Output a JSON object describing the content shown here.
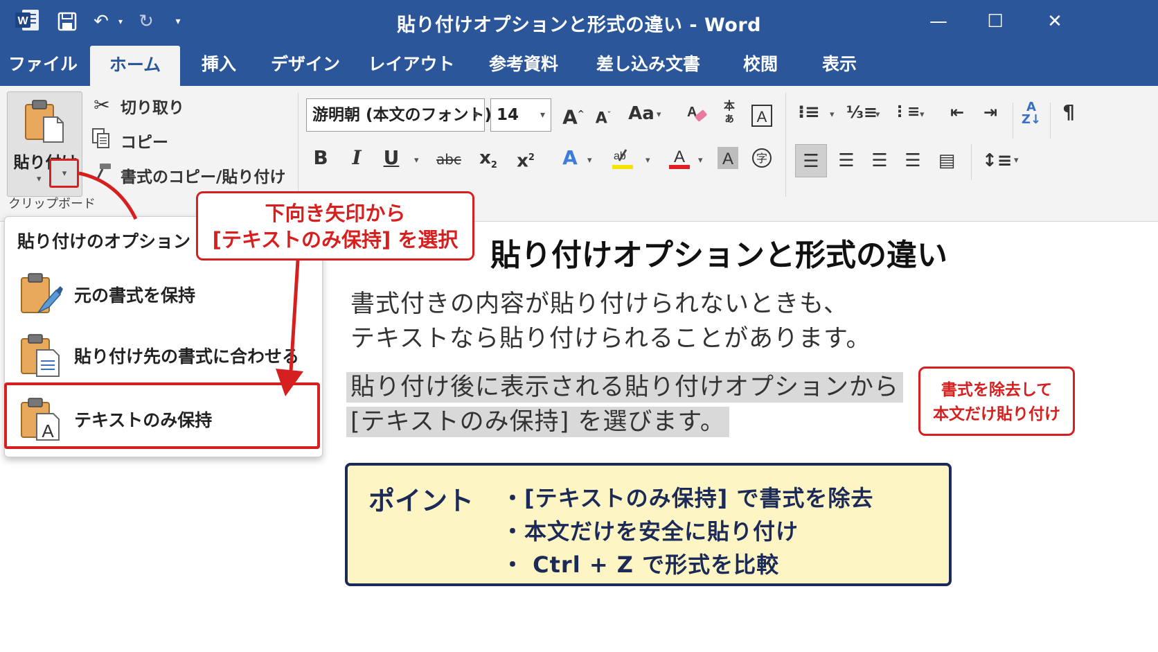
{
  "titlebar": {
    "title": "貼り付けオプションと形式の違い  -  Word",
    "icons": [
      "word-logo",
      "save-icon",
      "undo-icon",
      "redo-icon",
      "customize-icon",
      "minimize-icon",
      "maximize-icon",
      "close-icon"
    ]
  },
  "tabs": [
    {
      "label": "ファイル"
    },
    {
      "label": "ホーム",
      "active": true
    },
    {
      "label": "挿入"
    },
    {
      "label": "デザイン"
    },
    {
      "label": "レイアウト"
    },
    {
      "label": "参考資料"
    },
    {
      "label": "差し込み文書"
    },
    {
      "label": "校閲"
    },
    {
      "label": "表示"
    }
  ],
  "ribbon": {
    "paste_label": "貼り付け",
    "cut_label": "切り取り",
    "copy_label": "コピー",
    "format_painter_label": "書式のコピー/貼り付け",
    "clipboard_group": "クリップボード",
    "font_name": "游明朝 (本文のフォント)",
    "font_size": "14",
    "bold": "B",
    "italic": "I",
    "underline": "U",
    "strike": "abc",
    "change_case": "Aa"
  },
  "paste_options": {
    "title": "貼り付けのオプション",
    "items": [
      {
        "label": "元の書式を保持",
        "icon": "paste-keep-source-icon"
      },
      {
        "label": "貼り付け先の書式に合わせる",
        "icon": "paste-merge-icon"
      },
      {
        "label": "テキストのみ保持",
        "icon": "paste-text-only-icon",
        "selected": true
      }
    ]
  },
  "callouts": {
    "instruction_line1": "下向き矢印から",
    "instruction_line2": "[テキストのみ保持] を選択",
    "side_line1": "書式を除去して",
    "side_line2": "本文だけ貼り付け"
  },
  "document": {
    "title": "貼り付けオプションと形式の違い",
    "para1_line1": "書式付きの内容が貼り付けられないときも、",
    "para1_line2": "テキストなら貼り付けられることがあります。",
    "para2_line1": "貼り付け後に表示される貼り付けオプションから",
    "para2_line2": "[テキストのみ保持] を選びます。"
  },
  "point": {
    "label": "ポイント",
    "items": [
      "・[テキストのみ保持] で書式を除去",
      "・本文だけを安全に貼り付け",
      "・ Ctrl + Z で形式を比較"
    ]
  },
  "colors": {
    "word_blue": "#2b579a",
    "callout_red": "#d62020",
    "point_bg": "#fdf6c4",
    "point_border": "#1b2a57"
  }
}
